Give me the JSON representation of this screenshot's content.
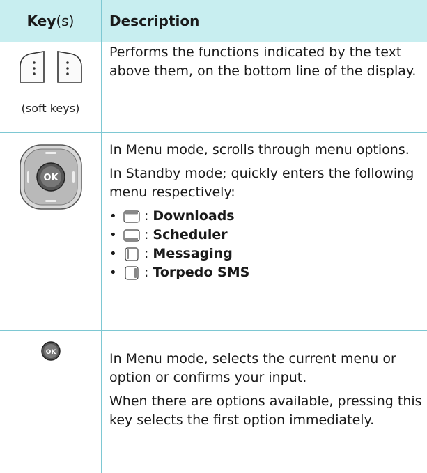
{
  "header": {
    "key_bold": "Key",
    "key_suffix": "(s)",
    "description": "Description"
  },
  "rows": [
    {
      "key_caption": "(soft keys)",
      "description": [
        "Performs the functions indicated by the text above them, on the bottom line of the display."
      ]
    },
    {
      "description": [
        "In Menu mode, scrolls through menu options.",
        "In Standby mode; quickly enters the following menu respectively:"
      ],
      "menu_items": [
        {
          "icon": "nav-up-icon",
          "separator": ":",
          "label": "Downloads"
        },
        {
          "icon": "nav-down-icon",
          "separator": ":",
          "label": "Scheduler"
        },
        {
          "icon": "nav-left-icon",
          "separator": ":",
          "label": "Messaging"
        },
        {
          "icon": "nav-right-icon",
          "separator": ":",
          "label": "Torpedo SMS"
        }
      ],
      "key_icon": "nav-ok-keypad-icon",
      "center_label": "OK"
    },
    {
      "description": [
        "In Menu mode, selects the current menu or option or confirms your input.",
        "When there are options available, pressing this key selects the first option immediately."
      ],
      "key_icon": "ok-key-icon",
      "center_label": "OK"
    }
  ],
  "colors": {
    "header_bg": "#c8eef0",
    "rule": "#7ec8d3"
  }
}
